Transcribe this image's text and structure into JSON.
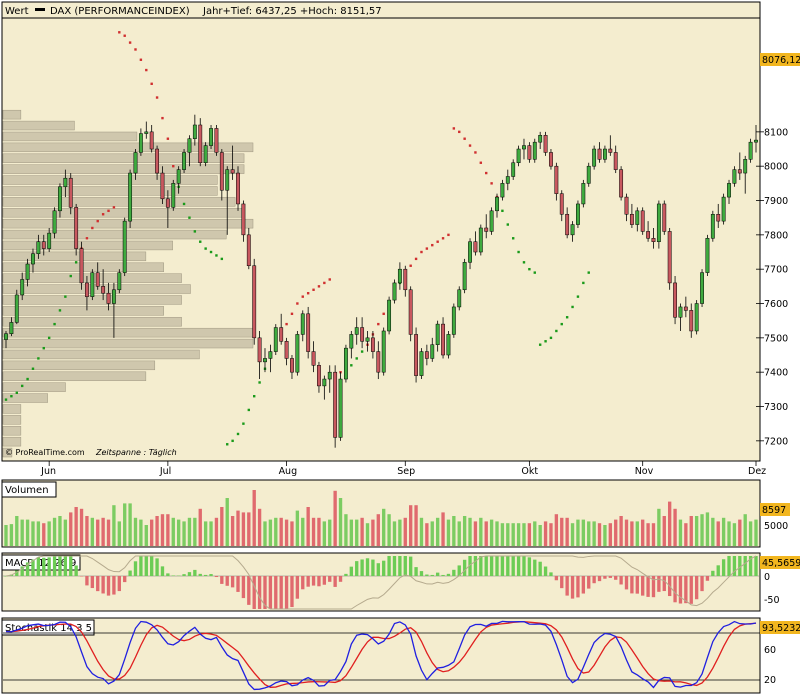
{
  "header": {
    "label": "Wert",
    "instrument": "DAX (PERFORMANCEINDEX)",
    "stats": "Jahr+Tief: 6437,25 +Hoch: 8151,57"
  },
  "colors": {
    "background": "#f4edcf",
    "up": "#3faa3f",
    "down": "#c8585f",
    "sar_up": "#1a9a1a",
    "sar_down": "#d03030",
    "volume_profile": "#cfc7ad",
    "macd_line": "#b5aa8e",
    "stoch_fast": "#2020e0",
    "stoch_slow": "#e02020",
    "tag_fill": "#f2b61f"
  },
  "main": {
    "credit": "© ProRealTime.com",
    "timeframe": "Zeitspanne : Täglich",
    "last_value": "8076,12",
    "months": [
      "Jun",
      "Jul",
      "Aug",
      "Sep",
      "Okt",
      "Nov",
      "Dez"
    ]
  },
  "volume": {
    "title": "Volumen",
    "last_value": "8597",
    "ticks": [
      "5000"
    ]
  },
  "macd": {
    "title": "MACD 12 26 9",
    "last_value": "45,5659",
    "ticks": [
      "0",
      "-50"
    ]
  },
  "stochastic": {
    "title": "Stochastik 14 3 5",
    "last_value": "93,5232",
    "ticks": [
      "60",
      "20"
    ]
  },
  "chart_data": {
    "type": "candlestick",
    "title": "DAX (PERFORMANCEINDEX)",
    "ylim": [
      7150,
      8420
    ],
    "yticks": [
      7200,
      7300,
      7400,
      7500,
      7600,
      7700,
      7800,
      7900,
      8000,
      8100
    ],
    "candles_per_month": [
      8,
      22,
      22,
      22,
      23,
      21,
      21,
      9
    ],
    "candles": [
      [
        7495,
        7520,
        7470,
        7512
      ],
      [
        7512,
        7560,
        7505,
        7545
      ],
      [
        7545,
        7640,
        7540,
        7625
      ],
      [
        7625,
        7690,
        7610,
        7670
      ],
      [
        7670,
        7730,
        7650,
        7715
      ],
      [
        7715,
        7760,
        7690,
        7745
      ],
      [
        7745,
        7800,
        7730,
        7780
      ],
      [
        7780,
        7800,
        7740,
        7760
      ],
      [
        7760,
        7820,
        7750,
        7805
      ],
      [
        7805,
        7880,
        7790,
        7870
      ],
      [
        7870,
        7950,
        7850,
        7940
      ],
      [
        7940,
        7990,
        7910,
        7965
      ],
      [
        7965,
        7980,
        7860,
        7880
      ],
      [
        7880,
        7890,
        7740,
        7760
      ],
      [
        7760,
        7780,
        7640,
        7660
      ],
      [
        7660,
        7680,
        7580,
        7620
      ],
      [
        7620,
        7700,
        7610,
        7690
      ],
      [
        7690,
        7720,
        7640,
        7650
      ],
      [
        7650,
        7700,
        7610,
        7630
      ],
      [
        7630,
        7660,
        7580,
        7600
      ],
      [
        7600,
        7660,
        7500,
        7640
      ],
      [
        7640,
        7700,
        7630,
        7690
      ],
      [
        7690,
        7850,
        7680,
        7840
      ],
      [
        7840,
        7990,
        7820,
        7980
      ],
      [
        7980,
        8050,
        7960,
        8040
      ],
      [
        8040,
        8110,
        8030,
        8095
      ],
      [
        8095,
        8130,
        8080,
        8100
      ],
      [
        8100,
        8120,
        8040,
        8050
      ],
      [
        8050,
        8060,
        7960,
        7980
      ],
      [
        7980,
        8000,
        7890,
        7905
      ],
      [
        7905,
        7930,
        7820,
        7880
      ],
      [
        7880,
        7960,
        7870,
        7950
      ],
      [
        7950,
        8000,
        7920,
        7990
      ],
      [
        7990,
        8050,
        7980,
        8040
      ],
      [
        8040,
        8090,
        8000,
        8080
      ],
      [
        8080,
        8150,
        8060,
        8120
      ],
      [
        8120,
        8140,
        8000,
        8010
      ],
      [
        8010,
        8070,
        8000,
        8060
      ],
      [
        8060,
        8120,
        8050,
        8110
      ],
      [
        8110,
        8120,
        8030,
        8040
      ],
      [
        8040,
        8050,
        7900,
        7930
      ],
      [
        7930,
        8000,
        7800,
        7990
      ],
      [
        7990,
        8060,
        7960,
        7980
      ],
      [
        7980,
        8000,
        7870,
        7890
      ],
      [
        7890,
        7900,
        7780,
        7800
      ],
      [
        7800,
        7820,
        7700,
        7710
      ],
      [
        7710,
        7730,
        7480,
        7500
      ],
      [
        7500,
        7520,
        7380,
        7430
      ],
      [
        7430,
        7470,
        7400,
        7440
      ],
      [
        7440,
        7480,
        7400,
        7460
      ],
      [
        7460,
        7540,
        7450,
        7530
      ],
      [
        7530,
        7570,
        7480,
        7490
      ],
      [
        7490,
        7500,
        7420,
        7440
      ],
      [
        7440,
        7450,
        7380,
        7400
      ],
      [
        7400,
        7520,
        7390,
        7510
      ],
      [
        7510,
        7580,
        7490,
        7570
      ],
      [
        7570,
        7590,
        7440,
        7460
      ],
      [
        7460,
        7490,
        7400,
        7420
      ],
      [
        7420,
        7430,
        7340,
        7360
      ],
      [
        7360,
        7390,
        7320,
        7380
      ],
      [
        7380,
        7420,
        7340,
        7400
      ],
      [
        7400,
        7420,
        7180,
        7210
      ],
      [
        7210,
        7400,
        7200,
        7380
      ],
      [
        7380,
        7480,
        7370,
        7470
      ],
      [
        7470,
        7520,
        7440,
        7510
      ],
      [
        7510,
        7560,
        7480,
        7530
      ],
      [
        7530,
        7560,
        7470,
        7490
      ],
      [
        7490,
        7520,
        7460,
        7500
      ],
      [
        7500,
        7520,
        7440,
        7460
      ],
      [
        7460,
        7490,
        7380,
        7400
      ],
      [
        7400,
        7530,
        7390,
        7520
      ],
      [
        7520,
        7620,
        7510,
        7610
      ],
      [
        7610,
        7670,
        7600,
        7660
      ],
      [
        7660,
        7720,
        7640,
        7700
      ],
      [
        7700,
        7710,
        7620,
        7640
      ],
      [
        7640,
        7650,
        7490,
        7510
      ],
      [
        7510,
        7530,
        7370,
        7390
      ],
      [
        7390,
        7470,
        7380,
        7460
      ],
      [
        7460,
        7480,
        7420,
        7440
      ],
      [
        7440,
        7500,
        7430,
        7480
      ],
      [
        7480,
        7550,
        7460,
        7540
      ],
      [
        7540,
        7560,
        7440,
        7450
      ],
      [
        7450,
        7520,
        7440,
        7510
      ],
      [
        7510,
        7600,
        7500,
        7590
      ],
      [
        7590,
        7650,
        7580,
        7640
      ],
      [
        7640,
        7730,
        7630,
        7720
      ],
      [
        7720,
        7790,
        7700,
        7780
      ],
      [
        7780,
        7810,
        7740,
        7750
      ],
      [
        7750,
        7830,
        7740,
        7820
      ],
      [
        7820,
        7860,
        7790,
        7810
      ],
      [
        7810,
        7880,
        7800,
        7870
      ],
      [
        7870,
        7920,
        7850,
        7910
      ],
      [
        7910,
        7960,
        7900,
        7950
      ],
      [
        7950,
        7990,
        7930,
        7970
      ],
      [
        7970,
        8020,
        7960,
        8010
      ],
      [
        8010,
        8060,
        8000,
        8050
      ],
      [
        8050,
        8080,
        8020,
        8060
      ],
      [
        8060,
        8070,
        8010,
        8020
      ],
      [
        8020,
        8080,
        8010,
        8070
      ],
      [
        8070,
        8100,
        8050,
        8090
      ],
      [
        8090,
        8100,
        8030,
        8040
      ],
      [
        8040,
        8050,
        7990,
        8000
      ],
      [
        8000,
        8010,
        7900,
        7920
      ],
      [
        7920,
        7930,
        7840,
        7860
      ],
      [
        7860,
        7880,
        7790,
        7800
      ],
      [
        7800,
        7840,
        7780,
        7830
      ],
      [
        7830,
        7900,
        7820,
        7890
      ],
      [
        7890,
        7960,
        7880,
        7950
      ],
      [
        7950,
        8010,
        7940,
        8000
      ],
      [
        8000,
        8060,
        7990,
        8050
      ],
      [
        8050,
        8070,
        8010,
        8020
      ],
      [
        8020,
        8060,
        8010,
        8050
      ],
      [
        8050,
        8090,
        8030,
        8040
      ],
      [
        8040,
        8060,
        7980,
        7990
      ],
      [
        7990,
        8000,
        7900,
        7910
      ],
      [
        7910,
        7920,
        7840,
        7860
      ],
      [
        7860,
        7890,
        7820,
        7830
      ],
      [
        7830,
        7880,
        7810,
        7870
      ],
      [
        7870,
        7880,
        7800,
        7810
      ],
      [
        7810,
        7840,
        7780,
        7790
      ],
      [
        7790,
        7820,
        7760,
        7780
      ],
      [
        7780,
        7900,
        7760,
        7890
      ],
      [
        7890,
        7900,
        7800,
        7810
      ],
      [
        7810,
        7820,
        7640,
        7660
      ],
      [
        7660,
        7680,
        7540,
        7560
      ],
      [
        7560,
        7600,
        7520,
        7590
      ],
      [
        7590,
        7620,
        7560,
        7580
      ],
      [
        7580,
        7600,
        7500,
        7520
      ],
      [
        7520,
        7610,
        7510,
        7600
      ],
      [
        7600,
        7700,
        7590,
        7690
      ],
      [
        7690,
        7800,
        7680,
        7790
      ],
      [
        7790,
        7870,
        7780,
        7860
      ],
      [
        7860,
        7890,
        7820,
        7840
      ],
      [
        7840,
        7920,
        7830,
        7910
      ],
      [
        7910,
        7960,
        7890,
        7950
      ],
      [
        7950,
        8000,
        7940,
        7990
      ],
      [
        7990,
        8040,
        7960,
        7980
      ],
      [
        7980,
        8030,
        7920,
        8020
      ],
      [
        8020,
        8080,
        8010,
        8070
      ],
      [
        8070,
        8120,
        8040,
        8076
      ]
    ],
    "sar": [
      [
        0,
        7320
      ],
      [
        1,
        7330
      ],
      [
        2,
        7340
      ],
      [
        3,
        7360
      ],
      [
        4,
        7380
      ],
      [
        5,
        7410
      ],
      [
        6,
        7440
      ],
      [
        7,
        7470
      ],
      [
        8,
        7500
      ],
      [
        9,
        7540
      ],
      [
        10,
        7580
      ],
      [
        11,
        7620
      ],
      [
        12,
        7680
      ],
      [
        13,
        7720
      ],
      [
        14,
        7760
      ],
      [
        15,
        7790
      ],
      [
        16,
        7820
      ],
      [
        17,
        7840
      ],
      [
        18,
        7860
      ],
      [
        19,
        7870
      ],
      [
        20,
        7880
      ],
      [
        21,
        8390
      ],
      [
        22,
        8380
      ],
      [
        23,
        8360
      ],
      [
        24,
        8340
      ],
      [
        25,
        8310
      ],
      [
        26,
        8280
      ],
      [
        27,
        8240
      ],
      [
        28,
        8200
      ],
      [
        29,
        8140
      ],
      [
        30,
        8080
      ],
      [
        31,
        8000
      ],
      [
        32,
        7940
      ],
      [
        33,
        7890
      ],
      [
        34,
        7850
      ],
      [
        35,
        7810
      ],
      [
        36,
        7780
      ],
      [
        37,
        7760
      ],
      [
        38,
        7750
      ],
      [
        39,
        7740
      ],
      [
        40,
        7730
      ],
      [
        41,
        7190
      ],
      [
        42,
        7200
      ],
      [
        43,
        7220
      ],
      [
        44,
        7250
      ],
      [
        45,
        7290
      ],
      [
        46,
        7330
      ],
      [
        47,
        7370
      ],
      [
        48,
        7410
      ],
      [
        49,
        7450
      ],
      [
        50,
        7480
      ],
      [
        51,
        7510
      ],
      [
        52,
        7540
      ],
      [
        53,
        7570
      ],
      [
        54,
        7600
      ],
      [
        55,
        7620
      ],
      [
        56,
        7630
      ],
      [
        57,
        7640
      ],
      [
        58,
        7650
      ],
      [
        59,
        7660
      ],
      [
        60,
        7670
      ],
      [
        61,
        7390
      ],
      [
        62,
        7400
      ],
      [
        63,
        7410
      ],
      [
        64,
        7420
      ],
      [
        65,
        7440
      ],
      [
        66,
        7460
      ],
      [
        67,
        7480
      ],
      [
        68,
        7510
      ],
      [
        69,
        7540
      ],
      [
        70,
        7570
      ],
      [
        71,
        7600
      ],
      [
        72,
        7630
      ],
      [
        73,
        7660
      ],
      [
        74,
        7690
      ],
      [
        75,
        7710
      ],
      [
        76,
        7730
      ],
      [
        77,
        7750
      ],
      [
        78,
        7760
      ],
      [
        79,
        7770
      ],
      [
        80,
        7780
      ],
      [
        81,
        7790
      ],
      [
        82,
        7800
      ],
      [
        83,
        8110
      ],
      [
        84,
        8100
      ],
      [
        85,
        8080
      ],
      [
        86,
        8060
      ],
      [
        87,
        8040
      ],
      [
        88,
        8010
      ],
      [
        89,
        7980
      ],
      [
        90,
        7950
      ],
      [
        91,
        7910
      ],
      [
        92,
        7870
      ],
      [
        93,
        7830
      ],
      [
        94,
        7790
      ],
      [
        95,
        7750
      ],
      [
        96,
        7720
      ],
      [
        97,
        7700
      ],
      [
        98,
        7690
      ],
      [
        99,
        7480
      ],
      [
        100,
        7490
      ],
      [
        101,
        7500
      ],
      [
        102,
        7520
      ],
      [
        103,
        7540
      ],
      [
        104,
        7560
      ],
      [
        105,
        7590
      ],
      [
        106,
        7620
      ],
      [
        107,
        7660
      ],
      [
        108,
        7690
      ]
    ]
  }
}
